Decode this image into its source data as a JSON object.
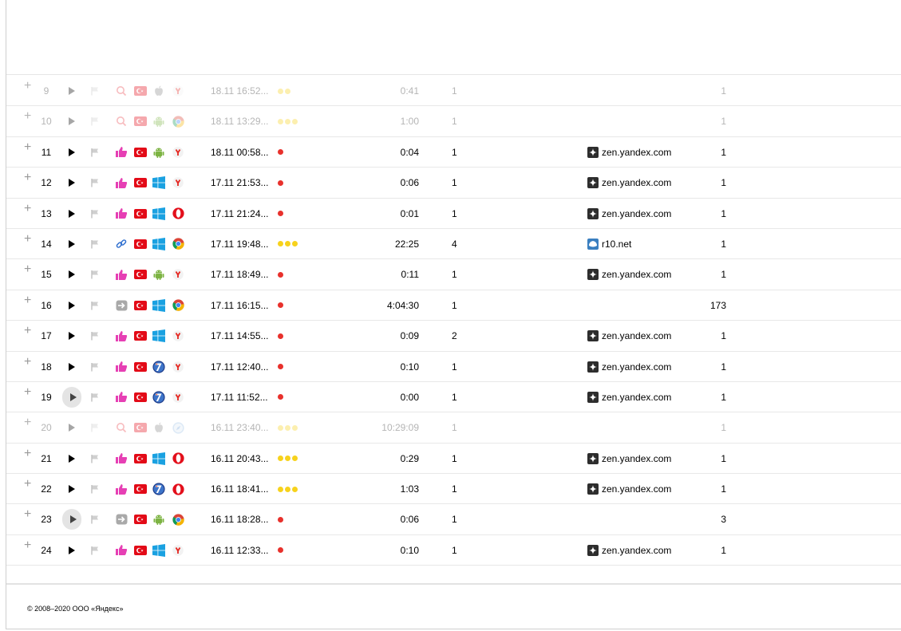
{
  "colors": {
    "red": "#e8312c",
    "yellow": "#f7d21c",
    "thumb": "#e63fb4",
    "flag_tr": "#e30a17"
  },
  "rows": [
    {
      "n": "9",
      "faded": true,
      "play": "triangle",
      "src": "search-icon",
      "os": "apple-icon",
      "br": "yandex-browser-icon",
      "date": "18.11 16:52...",
      "dots": [
        "yellow",
        "yellow"
      ],
      "dur": "0:41",
      "views": "1",
      "ref": "",
      "ref_icon": "",
      "cnt": "1"
    },
    {
      "n": "10",
      "faded": true,
      "play": "triangle",
      "src": "search-icon",
      "os": "android-icon",
      "br": "chrome-icon",
      "date": "18.11 13:29...",
      "dots": [
        "yellow",
        "yellow",
        "yellow"
      ],
      "dur": "1:00",
      "views": "1",
      "ref": "",
      "ref_icon": "",
      "cnt": "1"
    },
    {
      "n": "11",
      "faded": false,
      "play": "triangle",
      "src": "thumb-icon",
      "os": "android-icon",
      "br": "yandex-browser-icon",
      "date": "18.11 00:58...",
      "dots": [
        "red"
      ],
      "dur": "0:04",
      "views": "1",
      "ref": "zen.yandex.com",
      "ref_icon": "zen",
      "cnt": "1"
    },
    {
      "n": "12",
      "faded": false,
      "play": "triangle",
      "src": "thumb-icon",
      "os": "windows-icon",
      "br": "yandex-browser-icon",
      "date": "17.11 21:53...",
      "dots": [
        "red"
      ],
      "dur": "0:06",
      "views": "1",
      "ref": "zen.yandex.com",
      "ref_icon": "zen",
      "cnt": "1"
    },
    {
      "n": "13",
      "faded": false,
      "play": "triangle",
      "src": "thumb-icon",
      "os": "windows-icon",
      "br": "opera-icon",
      "date": "17.11 21:24...",
      "dots": [
        "red"
      ],
      "dur": "0:01",
      "views": "1",
      "ref": "zen.yandex.com",
      "ref_icon": "zen",
      "cnt": "1"
    },
    {
      "n": "14",
      "faded": false,
      "play": "triangle",
      "src": "link-icon",
      "os": "windows-icon",
      "br": "chrome-icon",
      "date": "17.11 19:48...",
      "dots": [
        "yellow",
        "yellow",
        "yellow"
      ],
      "dur": "22:25",
      "views": "4",
      "ref": "r10.net",
      "ref_icon": "r10",
      "cnt": "1"
    },
    {
      "n": "15",
      "faded": false,
      "play": "triangle",
      "src": "thumb-icon",
      "os": "android-icon",
      "br": "yandex-browser-icon",
      "date": "17.11 18:49...",
      "dots": [
        "red"
      ],
      "dur": "0:11",
      "views": "1",
      "ref": "zen.yandex.com",
      "ref_icon": "zen",
      "cnt": "1"
    },
    {
      "n": "16",
      "faded": false,
      "play": "triangle",
      "src": "direct-icon",
      "os": "windows-icon",
      "br": "chrome-icon",
      "date": "17.11 16:15...",
      "dots": [
        "red"
      ],
      "dur": "4:04:30",
      "views": "1",
      "ref": "",
      "ref_icon": "",
      "cnt": "173"
    },
    {
      "n": "17",
      "faded": false,
      "play": "triangle",
      "src": "thumb-icon",
      "os": "windows-icon",
      "br": "yandex-browser-icon",
      "date": "17.11 14:55...",
      "dots": [
        "red"
      ],
      "dur": "0:09",
      "views": "2",
      "ref": "zen.yandex.com",
      "ref_icon": "zen",
      "cnt": "1"
    },
    {
      "n": "18",
      "faded": false,
      "play": "triangle",
      "src": "thumb-icon",
      "os": "windows7-icon",
      "br": "yandex-browser-icon",
      "date": "17.11 12:40...",
      "dots": [
        "red"
      ],
      "dur": "0:10",
      "views": "1",
      "ref": "zen.yandex.com",
      "ref_icon": "zen",
      "cnt": "1"
    },
    {
      "n": "19",
      "faded": false,
      "play": "circle",
      "src": "thumb-icon",
      "os": "windows7-icon",
      "br": "yandex-browser-icon",
      "date": "17.11 11:52...",
      "dots": [
        "red"
      ],
      "dur": "0:00",
      "views": "1",
      "ref": "zen.yandex.com",
      "ref_icon": "zen",
      "cnt": "1"
    },
    {
      "n": "20",
      "faded": true,
      "play": "triangle",
      "src": "search-icon",
      "os": "apple-icon",
      "br": "safari-icon",
      "date": "16.11 23:40...",
      "dots": [
        "yellow",
        "yellow",
        "yellow"
      ],
      "dur": "10:29:09",
      "views": "1",
      "ref": "",
      "ref_icon": "",
      "cnt": "1"
    },
    {
      "n": "21",
      "faded": false,
      "play": "triangle",
      "src": "thumb-icon",
      "os": "windows-icon",
      "br": "opera-icon",
      "date": "16.11 20:43...",
      "dots": [
        "yellow",
        "yellow",
        "yellow"
      ],
      "dur": "0:29",
      "views": "1",
      "ref": "zen.yandex.com",
      "ref_icon": "zen",
      "cnt": "1"
    },
    {
      "n": "22",
      "faded": false,
      "play": "triangle",
      "src": "thumb-icon",
      "os": "windows7-icon",
      "br": "opera-icon",
      "date": "16.11 18:41...",
      "dots": [
        "yellow",
        "yellow",
        "yellow"
      ],
      "dur": "1:03",
      "views": "1",
      "ref": "zen.yandex.com",
      "ref_icon": "zen",
      "cnt": "1"
    },
    {
      "n": "23",
      "faded": false,
      "play": "circle",
      "src": "direct-icon",
      "os": "android-icon",
      "br": "chrome-icon",
      "date": "16.11 18:28...",
      "dots": [
        "red"
      ],
      "dur": "0:06",
      "views": "1",
      "ref": "",
      "ref_icon": "",
      "cnt": "3"
    },
    {
      "n": "24",
      "faded": false,
      "play": "triangle",
      "src": "thumb-icon",
      "os": "windows-icon",
      "br": "yandex-browser-icon",
      "date": "16.11 12:33...",
      "dots": [
        "red"
      ],
      "dur": "0:10",
      "views": "1",
      "ref": "zen.yandex.com",
      "ref_icon": "zen",
      "cnt": "1"
    }
  ],
  "footer": {
    "copyright": "© 2008–2020 ООО «Яндекс»"
  }
}
